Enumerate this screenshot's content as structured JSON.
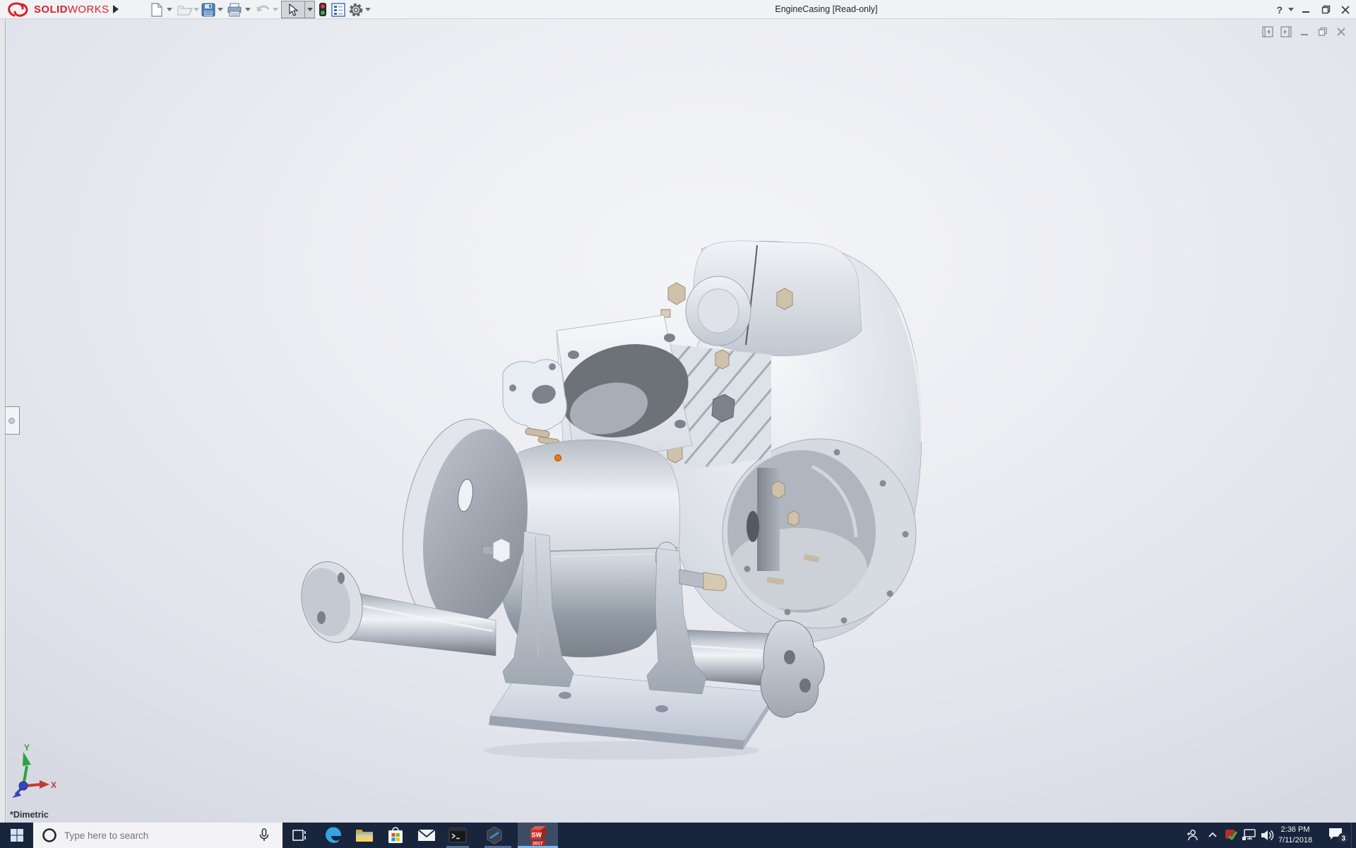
{
  "window": {
    "title": "EngineCasing [Read-only]",
    "brand_primary": "SOLID",
    "brand_secondary": "WORKS",
    "help_label": "?"
  },
  "toolbar": {
    "items": [
      {
        "id": "new-document",
        "dropdown": true,
        "enabled": true
      },
      {
        "id": "open",
        "dropdown": true,
        "enabled": false
      },
      {
        "id": "save",
        "dropdown": true,
        "enabled": true
      },
      {
        "id": "print",
        "dropdown": true,
        "enabled": true
      },
      {
        "id": "undo",
        "dropdown": true,
        "enabled": false
      },
      {
        "id": "select",
        "dropdown": true,
        "enabled": true,
        "pressed": true
      },
      {
        "id": "rebuild-traffic-light",
        "dropdown": false,
        "enabled": true
      },
      {
        "id": "file-properties",
        "dropdown": false,
        "enabled": true
      },
      {
        "id": "options-gear",
        "dropdown": true,
        "enabled": true
      }
    ]
  },
  "viewport": {
    "view_orientation_label": "*Dimetric",
    "triad": {
      "x_label": "X",
      "y_label": "Y"
    },
    "doc_controls": [
      "show-left-pane",
      "show-right-pane",
      "minimize",
      "restore",
      "close"
    ]
  },
  "taskbar": {
    "search_placeholder": "Type here to search",
    "apps": [
      {
        "name": "task-view"
      },
      {
        "name": "edge"
      },
      {
        "name": "file-explorer"
      },
      {
        "name": "store"
      },
      {
        "name": "mail"
      },
      {
        "name": "command-prompt",
        "open": true
      },
      {
        "name": "hexagon-app",
        "open": true
      },
      {
        "name": "solidworks-2017",
        "open": true,
        "active": true,
        "label": "SW",
        "year": "2017"
      }
    ],
    "tray": {
      "time": "2:36 PM",
      "date": "7/11/2018",
      "notification_count": "3"
    }
  },
  "colors": {
    "brand_red": "#d6232a",
    "taskbar_bg": "#19253c",
    "active_cell": "#3d4c66",
    "underline": "#54719a",
    "underline_active": "#76b9e8",
    "save_blue": "#4f7fb5",
    "hardware_beige": "#cfc2ab",
    "selection_marker_orange": "#f07800",
    "axis_x_red": "#c23b33",
    "axis_y_green": "#2aa43c",
    "axis_z_blue": "#3644bb",
    "traffic_red": "#e03c31",
    "traffic_green": "#3fae49"
  }
}
